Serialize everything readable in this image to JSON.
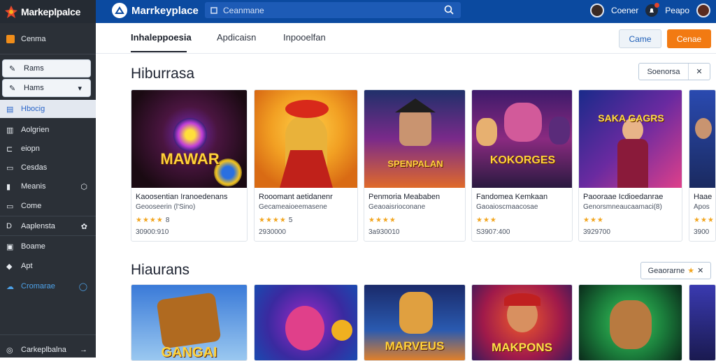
{
  "topbar": {
    "brand": "Markeplpalce",
    "app_title": "Marrkeyplace",
    "search_placeholder": "Ceanmane",
    "user_name": "Coener",
    "user2_name": "Peapo"
  },
  "sidebar": {
    "items": [
      {
        "label": "Cenma",
        "icon": "grid-icon"
      },
      {
        "label": "Rams",
        "icon": "edit-icon"
      },
      {
        "label": "Hams",
        "icon": "pencil-icon"
      },
      {
        "label": "Hbocig",
        "icon": "document-icon"
      },
      {
        "label": "Aolgrien",
        "icon": "chart-icon"
      },
      {
        "label": "eiopn",
        "icon": "bracket-icon"
      },
      {
        "label": "Cesdas",
        "icon": "card-icon"
      },
      {
        "label": "Meanis",
        "icon": "bar-icon"
      },
      {
        "label": "Come",
        "icon": "folder-icon"
      },
      {
        "label": "Aaplensta",
        "icon": "d-icon"
      },
      {
        "label": "Boame",
        "icon": "box-icon"
      },
      {
        "label": "Apt",
        "icon": "shape-icon"
      },
      {
        "label": "Cromarae",
        "icon": "cloud-icon"
      },
      {
        "label": "Carkeplbalna",
        "icon": "compass-icon"
      }
    ]
  },
  "tabs": [
    {
      "label": "Inhaleppoesia"
    },
    {
      "label": "Apdicaisn"
    },
    {
      "label": "Inpooelfan"
    }
  ],
  "header_buttons": {
    "secondary": "Came",
    "primary": "Cenae"
  },
  "sections": [
    {
      "title": "Hiburrasa",
      "filter_label": "Soenorsa",
      "cards": [
        {
          "name": "Kaoosentian Iranoedenans",
          "sub": "Geooseerin (l'Sino)",
          "stars": "★★★★",
          "rating": "8",
          "price": "30900:910",
          "art_text": "MAWAR"
        },
        {
          "name": "Rooomant aetidanenr",
          "sub": "Gecameaioeemasene",
          "stars": "★★★★",
          "rating": "5",
          "price": "2930000",
          "art_text": ""
        },
        {
          "name": "Penmoria Meababen",
          "sub": "Geaoaisrioconane",
          "stars": "★★★★",
          "rating": "",
          "price": "3a930010",
          "art_text": "SPENPALAN"
        },
        {
          "name": "Fandomea Kemkaan",
          "sub": "Gaoaioscmaacosae",
          "stars": "★★★",
          "rating": "",
          "price": "S3907:400",
          "art_text": "KOKORGES"
        },
        {
          "name": "Paooraae Icdioedanrae",
          "sub": "Genorsmneaucaamaci(8)",
          "stars": "★★★",
          "rating": "",
          "price": "3929700",
          "art_text": "SAKA GAGRS"
        },
        {
          "name": "Haae",
          "sub": "Apos",
          "stars": "★★★",
          "rating": "",
          "price": "3900",
          "art_text": ""
        }
      ]
    },
    {
      "title": "Hiaurans",
      "filter_label": "Geaorarne",
      "cards": [
        {
          "art_text": "GANGAI"
        },
        {
          "art_text": ""
        },
        {
          "art_text": "MARVEUS"
        },
        {
          "art_text": "MAKPONS"
        },
        {
          "art_text": ""
        },
        {
          "art_text": ""
        }
      ]
    }
  ],
  "colors": {
    "topbar": "#0b4aa0",
    "sidebar": "#2b3037",
    "accent": "#f27a12",
    "link": "#1f5fb8"
  }
}
